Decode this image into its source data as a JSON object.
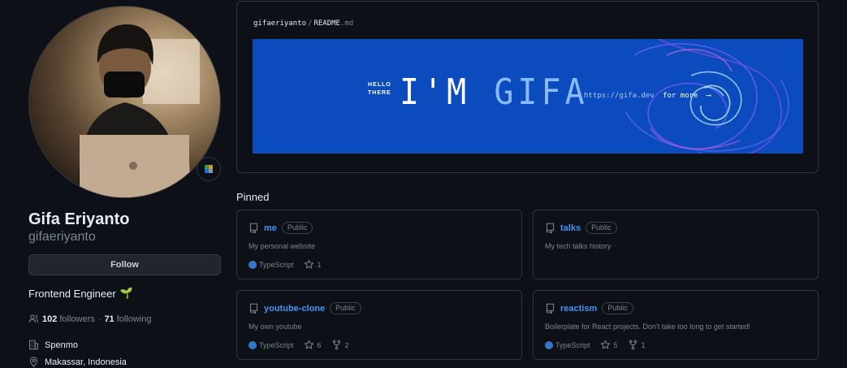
{
  "profile": {
    "name": "Gifa Eriyanto",
    "login": "gifaeriyanto",
    "follow_label": "Follow",
    "bio": "Frontend Engineer",
    "bio_emoji": "🌱",
    "followers_count": "102",
    "followers_label": "followers",
    "separator": "·",
    "following_count": "71",
    "following_label": "following",
    "organization": "Spenmo",
    "location": "Makassar, Indonesia"
  },
  "readme": {
    "owner": "gifaeriyanto",
    "separator": "/",
    "file_name": "README",
    "file_ext": ".md",
    "banner": {
      "hello": "HELLO",
      "there": "THERE",
      "im": "I'M",
      "name": "GIFA",
      "url": "https://gifa.dev",
      "more": "for more",
      "arrow": "⟶",
      "background_color": "#0b4bbd"
    }
  },
  "pinned": {
    "title": "Pinned",
    "repos": [
      {
        "name": "me",
        "visibility": "Public",
        "description": "My personal website",
        "language": "TypeScript",
        "stars": "1",
        "forks": ""
      },
      {
        "name": "talks",
        "visibility": "Public",
        "description": "My tech talks history",
        "language": "",
        "stars": "",
        "forks": ""
      },
      {
        "name": "youtube-clone",
        "visibility": "Public",
        "description": "My own youtube",
        "language": "TypeScript",
        "stars": "6",
        "forks": "2"
      },
      {
        "name": "reactism",
        "visibility": "Public",
        "description": "Boilerplate for React projects. Don't take too long to get started!",
        "language": "TypeScript",
        "stars": "5",
        "forks": "1"
      }
    ]
  },
  "colors": {
    "background": "#0d1117",
    "border": "#30363d",
    "link": "#4493f8",
    "typescript": "#3178c6"
  }
}
